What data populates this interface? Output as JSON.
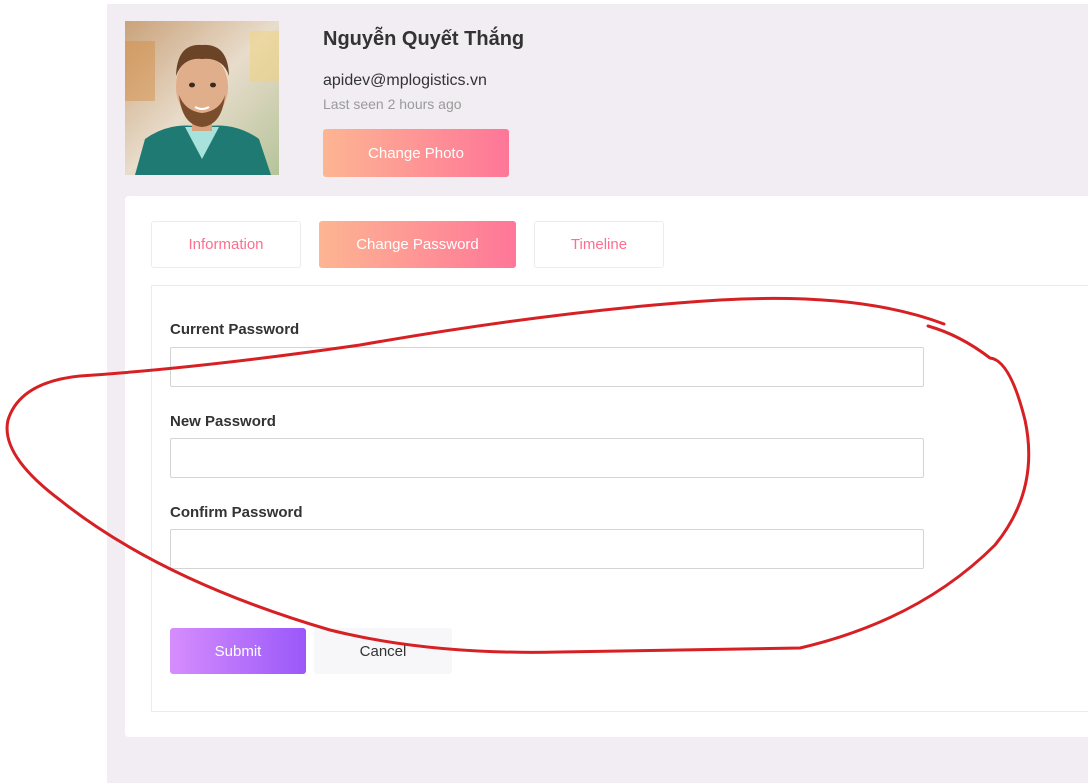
{
  "profile": {
    "name": "Nguyễn Quyết Thắng",
    "email": "apidev@mplogistics.vn",
    "last_seen": "Last seen 2 hours ago",
    "change_photo_label": "Change Photo"
  },
  "tabs": [
    {
      "label": "Information",
      "active": false
    },
    {
      "label": "Change Password",
      "active": true
    },
    {
      "label": "Timeline",
      "active": false
    }
  ],
  "form": {
    "fields": [
      {
        "label": "Current Password",
        "value": ""
      },
      {
        "label": "New Password",
        "value": ""
      },
      {
        "label": "Confirm Password",
        "value": ""
      }
    ],
    "submit_label": "Submit",
    "cancel_label": "Cancel"
  },
  "colors": {
    "accent_gradient_start": "#fdb592",
    "accent_gradient_end": "#fe7698",
    "submit_gradient_start": "#d68dfd",
    "submit_gradient_end": "#9a58f9",
    "annotation_red": "#d62024",
    "page_background": "#f1edf3"
  },
  "annotation": {
    "shape": "hand-drawn-ellipse",
    "color": "#d62024"
  }
}
